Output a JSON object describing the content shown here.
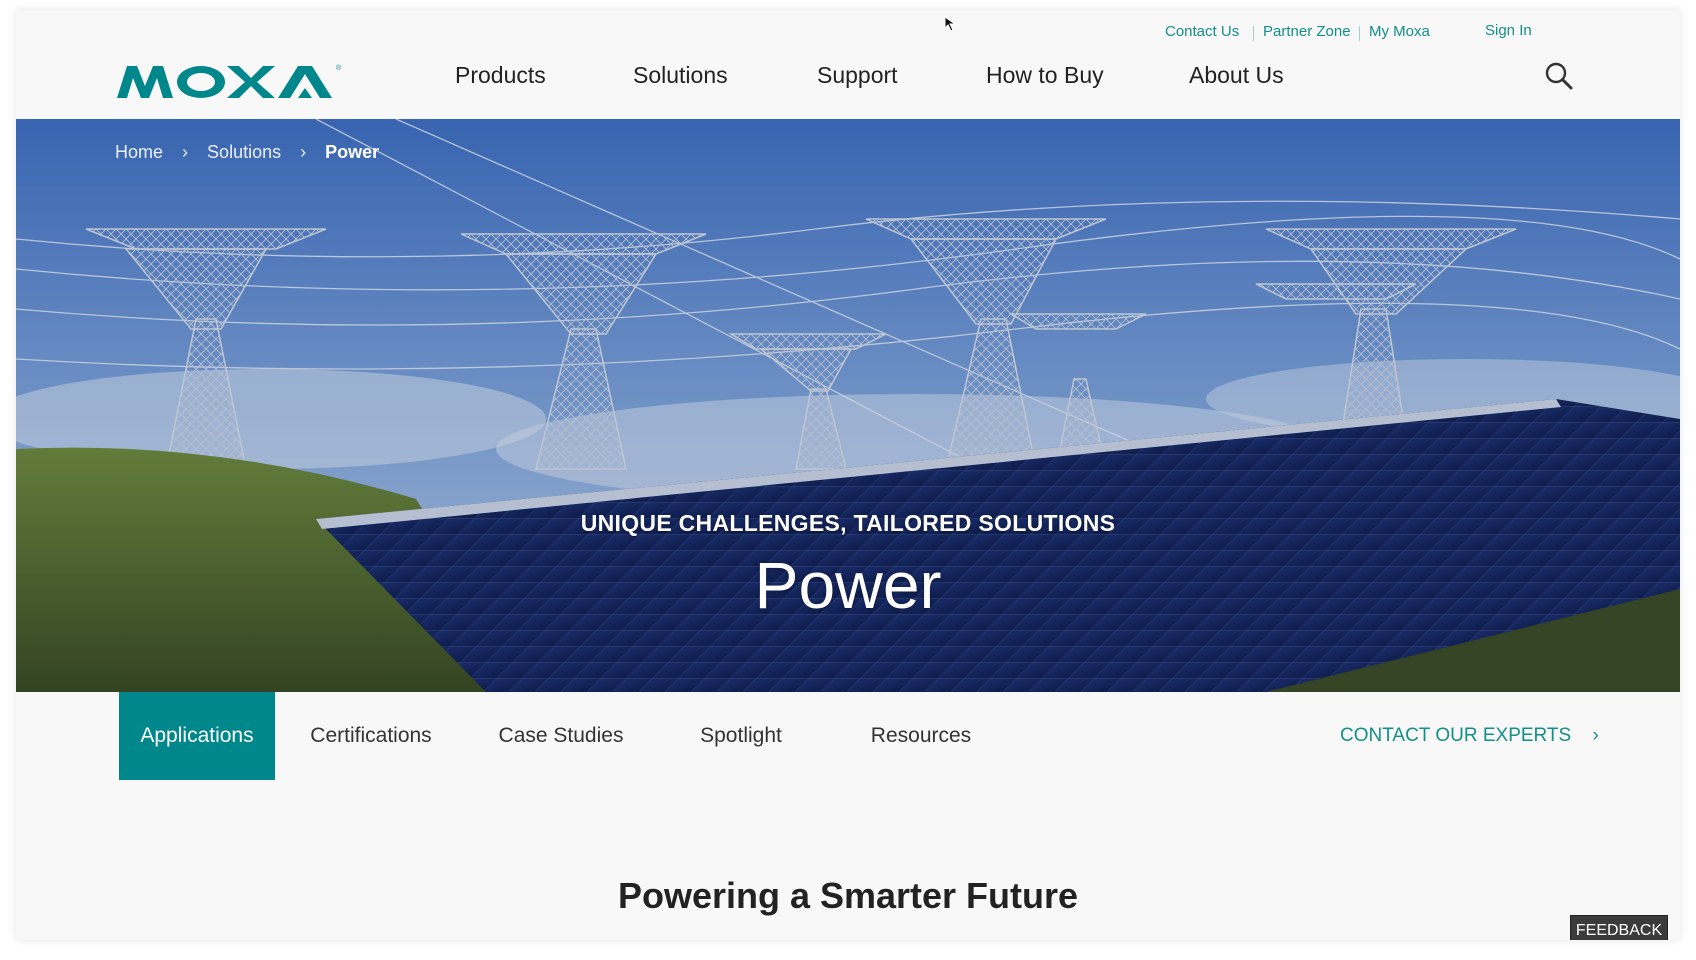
{
  "utility_nav": {
    "contact_us": "Contact Us",
    "partner_zone": "Partner Zone",
    "my_moxa": "My Moxa",
    "sign_in": "Sign In"
  },
  "brand": {
    "name": "MOXA",
    "color": "#00878b"
  },
  "main_nav": {
    "items": [
      {
        "label": "Products"
      },
      {
        "label": "Solutions"
      },
      {
        "label": "Support"
      },
      {
        "label": "How to Buy"
      },
      {
        "label": "About Us"
      }
    ],
    "search_icon": "search-icon"
  },
  "breadcrumb": {
    "items": [
      "Home",
      "Solutions"
    ],
    "current": "Power",
    "separator_icon": "chevron-right-icon"
  },
  "hero": {
    "kicker": "UNIQUE CHALLENGES, TAILORED SOLUTIONS",
    "title": "Power"
  },
  "sub_nav": {
    "tabs": [
      {
        "label": "Applications",
        "active": true
      },
      {
        "label": "Certifications",
        "active": false
      },
      {
        "label": "Case Studies",
        "active": false
      },
      {
        "label": "Spotlight",
        "active": false
      },
      {
        "label": "Resources",
        "active": false
      }
    ],
    "cta": "CONTACT OUR EXPERTS",
    "cta_icon": "chevron-right-icon"
  },
  "section": {
    "title": "Powering a Smarter Future"
  },
  "feedback": {
    "label": "FEEDBACK"
  },
  "colors": {
    "accent": "#00878b",
    "link": "#138f8a",
    "text": "#222222"
  }
}
